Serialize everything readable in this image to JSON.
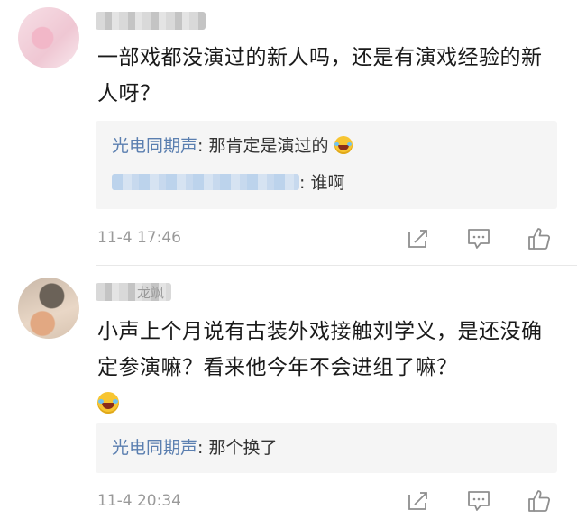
{
  "comments": [
    {
      "body": "一部戏都没演过的新人吗，还是有演戏经验的新人呀？",
      "replies": [
        {
          "author": "光电同期声",
          "separator": ":",
          "text": " 那肯定是演过的"
        },
        {
          "separator": ":",
          "text": " 谁啊"
        }
      ],
      "time": "11-4 17:46"
    },
    {
      "username_tail": "龙飒",
      "body": "小声上个月说有古装外戏接触刘学义，是还没确定参演嘛？看来他今年不会进组了嘛？",
      "replies": [
        {
          "author": "光电同期声",
          "separator": ":",
          "text": " 那个换了"
        }
      ],
      "time": "11-4 20:34"
    }
  ],
  "icons": {
    "share": "share-icon",
    "comment": "comment-icon",
    "like": "thumbs-up-icon",
    "emoji": "laughing-tears-emoji-icon"
  },
  "colors": {
    "reply_author": "#5b7fb0",
    "reply_background": "#f5f5f5",
    "meta_text": "#9a9a9a"
  }
}
